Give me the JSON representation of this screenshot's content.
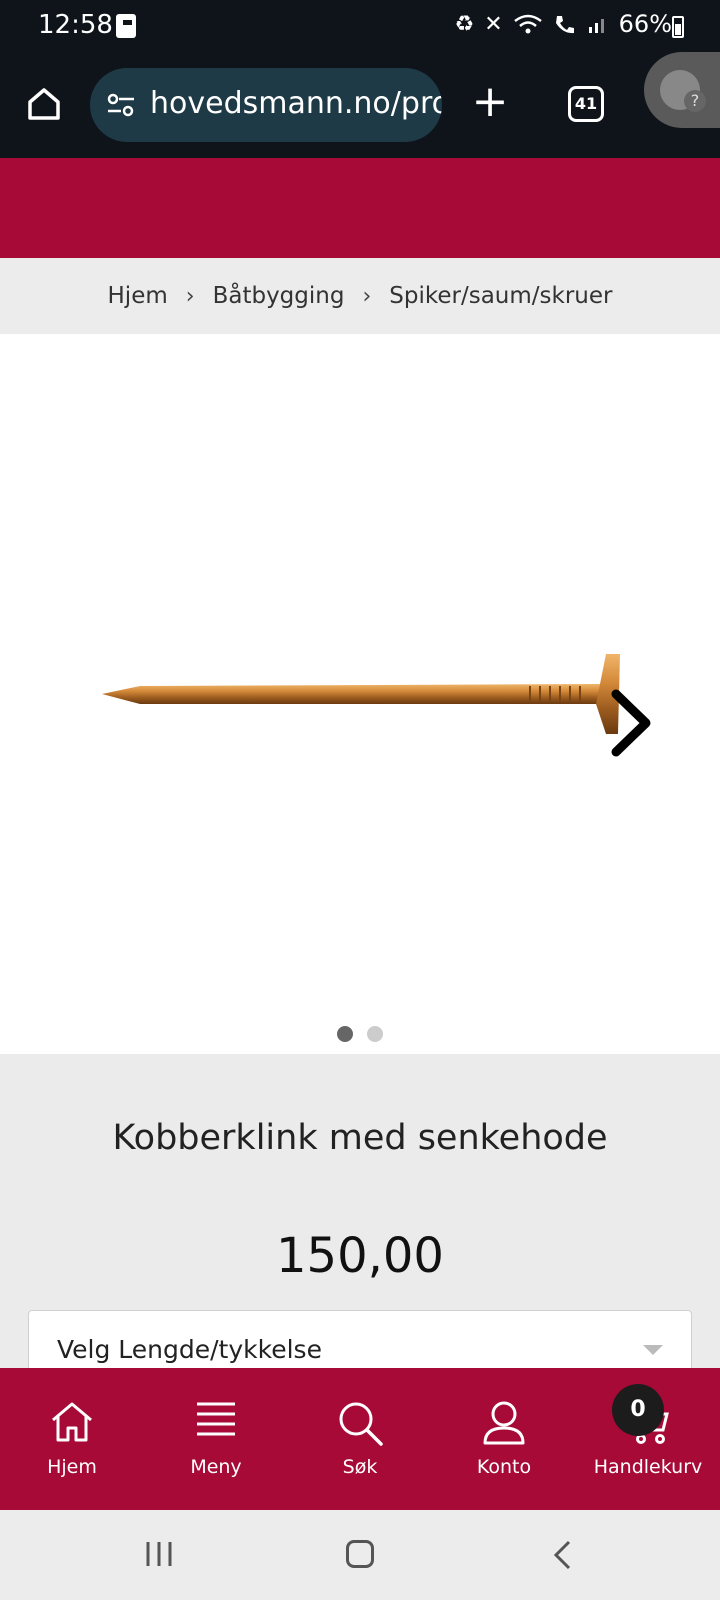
{
  "status_bar": {
    "time": "12:58",
    "battery": "66%",
    "icons": [
      "flipboard-icon",
      "battery-saver-icon",
      "mute-icon",
      "wifi-icon",
      "wifi-call-icon",
      "signal-icon",
      "battery-icon"
    ]
  },
  "browser": {
    "url": "hovedsmann.no/prod",
    "tab_count": "41"
  },
  "breadcrumb": {
    "items": [
      "Hjem",
      "Båtbygging",
      "Spiker/saum/skruer"
    ]
  },
  "gallery": {
    "image_name": "kobberklink-nail",
    "image_count": 2,
    "active_index": 0
  },
  "product": {
    "title": "Kobberklink med senkehode",
    "price": "150,00",
    "variant_placeholder": "Velg Lengde/tykkelse"
  },
  "bottom_nav": {
    "items": [
      {
        "label": "Hjem",
        "icon": "home-icon"
      },
      {
        "label": "Meny",
        "icon": "menu-icon"
      },
      {
        "label": "Søk",
        "icon": "search-icon"
      },
      {
        "label": "Konto",
        "icon": "account-icon"
      },
      {
        "label": "Handlekurv",
        "icon": "cart-icon"
      }
    ],
    "cart_count": "0"
  },
  "colors": {
    "brand": "#a70a36",
    "browser_bg": "#0f141b",
    "url_pill": "#1e3a46"
  }
}
